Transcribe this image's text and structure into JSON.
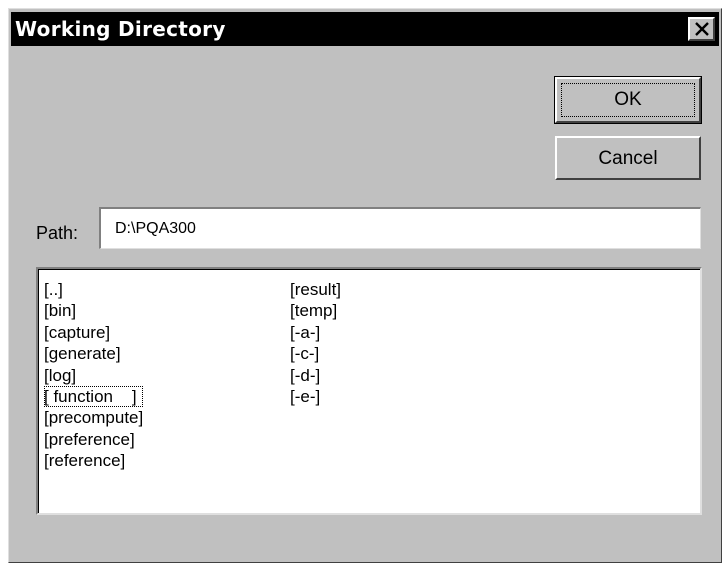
{
  "dialog": {
    "title": "Working Directory",
    "close_glyph": "×"
  },
  "buttons": {
    "ok_label": "OK",
    "cancel_label": "Cancel"
  },
  "path": {
    "label": "Path:",
    "value": "D:\\PQA300"
  },
  "directories": {
    "column1": [
      "[..]",
      "[bin]",
      "[capture]",
      "[generate]",
      "[log]",
      "[ function    ]",
      "[precompute]",
      "[preference]",
      "[reference]"
    ],
    "column2": [
      "[result]",
      "[temp]",
      "[-a-]",
      "[-c-]",
      "[-d-]",
      "[-e-]"
    ],
    "selected": "[ function    ]"
  },
  "colors": {
    "dialog_face": "#c0c0c0",
    "titlebar": "#000000",
    "title_text": "#ffffff",
    "field_background": "#ffffff"
  }
}
